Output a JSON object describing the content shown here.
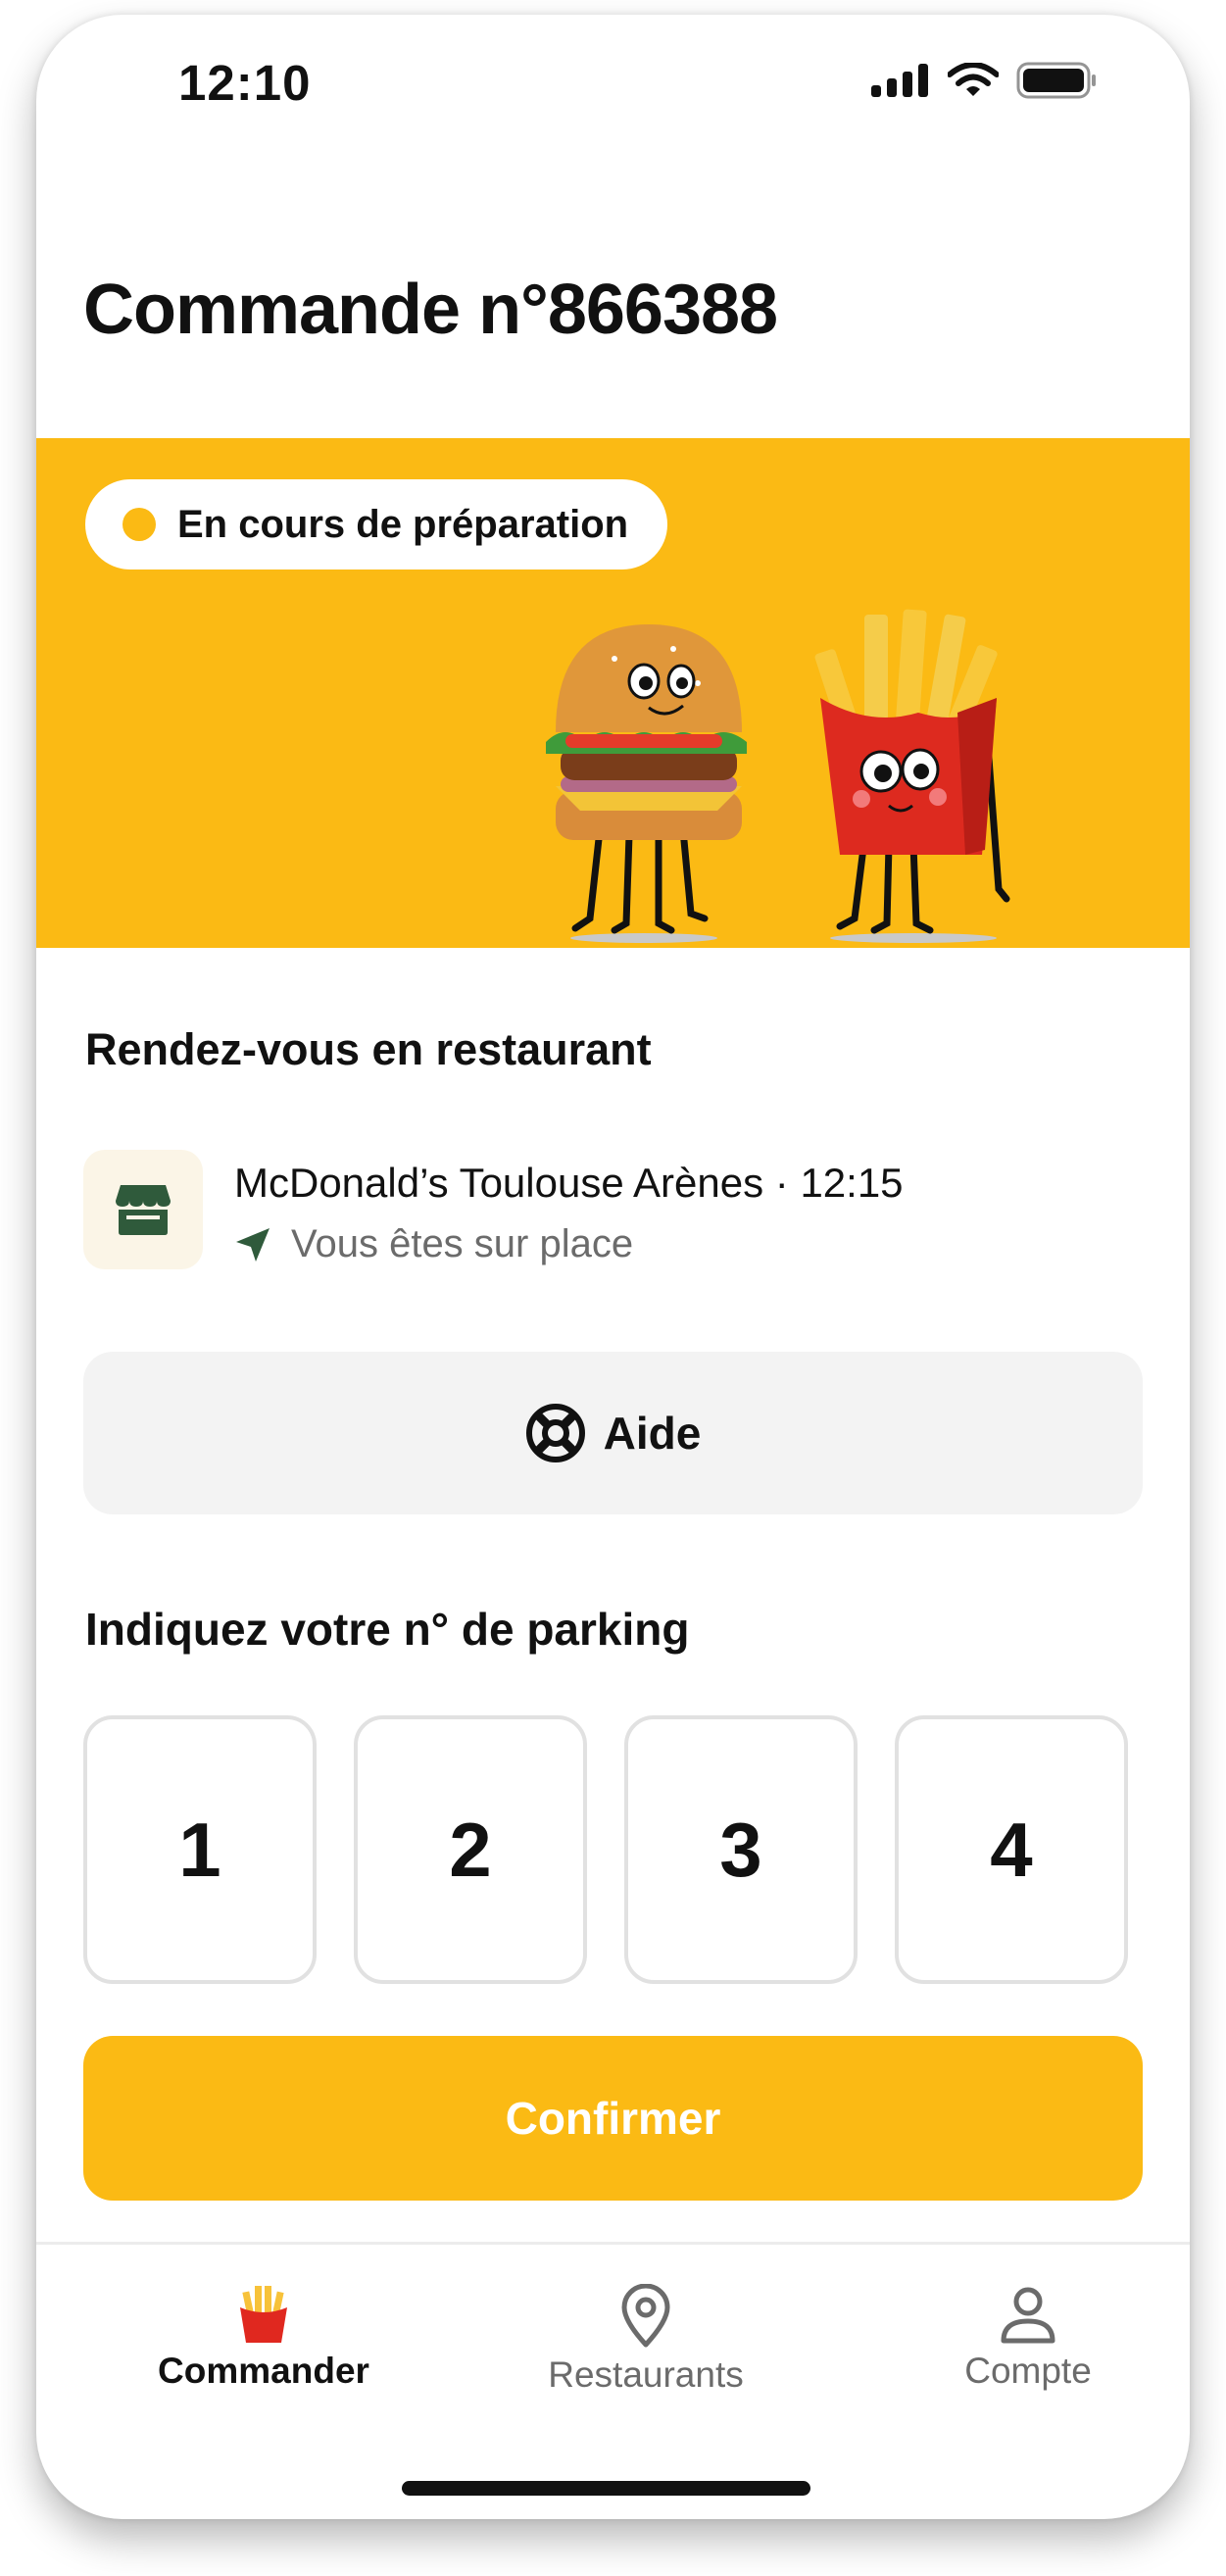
{
  "status_bar": {
    "time": "12:10"
  },
  "order": {
    "title": "Commande n°866388",
    "status_label": "En cours de préparation"
  },
  "meeting": {
    "heading": "Rendez-vous en restaurant",
    "restaurant_name": "McDonald’s Toulouse Arènes · 12:15",
    "location_status": "Vous êtes sur place"
  },
  "help_button": {
    "label": "Aide"
  },
  "parking": {
    "heading": "Indiquez votre n° de parking",
    "spots": [
      "1",
      "2",
      "3",
      "4"
    ]
  },
  "confirm_button": {
    "label": "Confirmer"
  },
  "tab_bar": {
    "items": [
      {
        "label": "Commander",
        "icon": "fries-icon",
        "active": true
      },
      {
        "label": "Restaurants",
        "icon": "map-pin-icon",
        "active": false
      },
      {
        "label": "Compte",
        "icon": "user-icon",
        "active": false
      }
    ]
  },
  "colors": {
    "accent": "#fbba14",
    "store_icon": "#2f5a3b",
    "muted_text": "#6b6b6b"
  }
}
